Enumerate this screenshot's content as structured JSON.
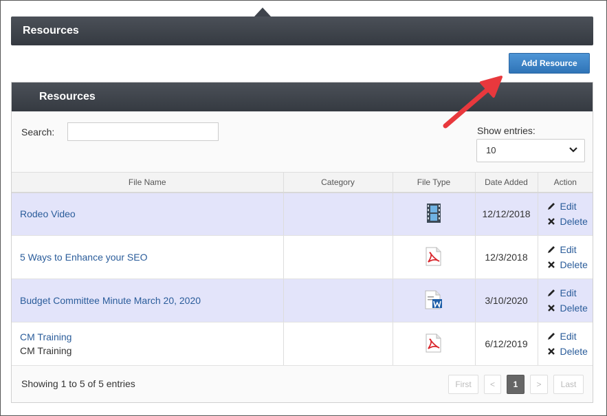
{
  "header": {
    "title": "Resources"
  },
  "toolbar": {
    "add_label": "Add Resource"
  },
  "panel": {
    "title": "Resources"
  },
  "search": {
    "label": "Search:",
    "value": "",
    "placeholder": ""
  },
  "entries": {
    "label": "Show entries:",
    "selected": "10"
  },
  "table": {
    "headers": [
      "File Name",
      "Category",
      "File Type",
      "Date Added",
      "Action"
    ],
    "rows": [
      {
        "name": "Rodeo Video",
        "subtitle": "",
        "category": "",
        "type": "video-file-icon",
        "date": "12/12/2018",
        "edit": "Edit",
        "delete": "Delete"
      },
      {
        "name": "5 Ways to Enhance your SEO",
        "subtitle": "",
        "category": "",
        "type": "pdf-file-icon",
        "date": "12/3/2018",
        "edit": "Edit",
        "delete": "Delete"
      },
      {
        "name": "Budget Committee Minute March 20, 2020",
        "subtitle": "",
        "category": "",
        "type": "word-file-icon",
        "date": "3/10/2020",
        "edit": "Edit",
        "delete": "Delete"
      },
      {
        "name": "CM Training",
        "subtitle": "CM Training",
        "category": "",
        "type": "pdf-file-icon",
        "date": "6/12/2019",
        "edit": "Edit",
        "delete": "Delete"
      }
    ]
  },
  "footer": {
    "info": "Showing 1 to 5 of 5 entries"
  },
  "pagination": {
    "first": "First",
    "prev": "<",
    "current": "1",
    "next": ">",
    "last": "Last"
  },
  "colors": {
    "header_bg": "#3f444c",
    "accent": "#3a82c6",
    "link": "#2a5c9a",
    "row_alt": "#e3e4fa",
    "arrow": "#e8383d"
  }
}
